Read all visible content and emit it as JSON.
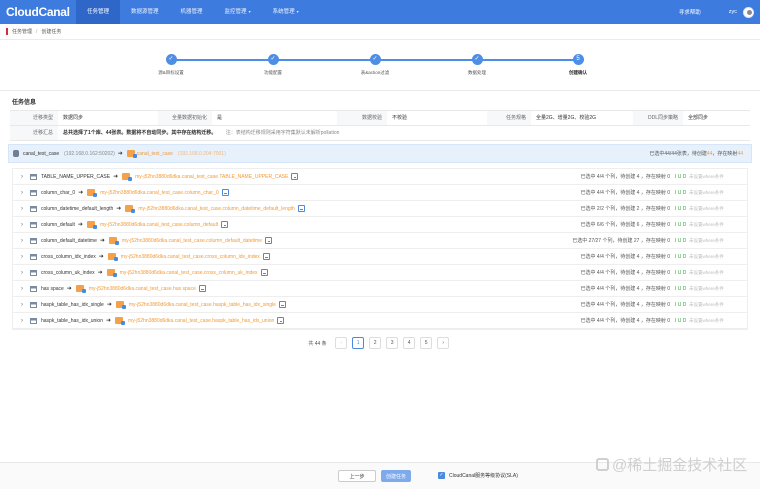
{
  "topbar": {
    "logo": "CloudCanal",
    "nav": [
      {
        "label": "任务管理",
        "active": true,
        "dropdown": false
      },
      {
        "label": "数据源管理",
        "active": false,
        "dropdown": false
      },
      {
        "label": "机器管理",
        "active": false,
        "dropdown": false
      },
      {
        "label": "监控管理",
        "active": false,
        "dropdown": true
      },
      {
        "label": "系统管理",
        "active": false,
        "dropdown": true
      }
    ],
    "help": "寻求帮助",
    "user": "zyc",
    "caret": "▾"
  },
  "breadcrumb": {
    "root": "任务管理",
    "sep": "/",
    "current": "创建任务"
  },
  "steps": [
    {
      "label": "源&目标设置",
      "check": "✓"
    },
    {
      "label": "功能配置",
      "check": "✓"
    },
    {
      "label": "表&action过滤",
      "check": "✓"
    },
    {
      "label": "数据处理",
      "check": "✓"
    },
    {
      "label": "创建确认",
      "check": "5"
    }
  ],
  "task_info": {
    "title": "任务信息",
    "row1": [
      {
        "label": "迁移类型",
        "value": "数据同步"
      },
      {
        "label": "全量数据初始化",
        "value": "是"
      },
      {
        "label": "数据校验",
        "value": "不校验"
      },
      {
        "label": "任务规格",
        "value": "全量2G、增量2G、校验2G"
      },
      {
        "label": "DDL同步策略",
        "value": "全部同步"
      }
    ],
    "summary_label": "迁移汇总",
    "summary_text": "总共选择了1个库、44张表。数据将不自动同步。其中存在结构迁移。",
    "summary_note": "注：表结构迁移规则采用字符集默认未解析pollation"
  },
  "db_bar": {
    "source_db": "canal_test_case",
    "source_host": "(192.168.0.162:50202)",
    "arrow": "➜",
    "target_db": "canal_test_case",
    "target_host": "(192.168.0.204:7001)",
    "summary_prefix": "已选中44/44张表，待创建",
    "summary_count": "44",
    "summary_mid": "，存在映射",
    "summary_count2": "44"
  },
  "rows": [
    {
      "expand": "›",
      "src": "TABLE_NAME_UPPER_CASE",
      "arrow": "➜",
      "dst": "my-j52hn3880d6dka.canal_test_case.TABLE_NAME_UPPER_CASE",
      "selected": "已选中 4/4 个列，待创建 4 ，存在映射 0",
      "iud": "I U D",
      "filter": "未设置where条件"
    },
    {
      "expand": "›",
      "src": "column_char_0",
      "arrow": "➜",
      "dst": "my-j52hn3880d6dka.canal_test_case.column_char_0",
      "selected": "已选中 4/4 个列，待创建 4 ，存在映射 0",
      "iud": "I U D",
      "filter": "未设置where条件"
    },
    {
      "expand": "›",
      "src": "column_datetime_default_length",
      "arrow": "➜",
      "dst": "my-j52hn3880d6dka.canal_test_case.column_datetime_default_length",
      "selected": "已选中 2/2 个列，待创建 2 ，存在映射 0",
      "iud": "I U D",
      "filter": "未设置where条件"
    },
    {
      "expand": "›",
      "src": "column_default",
      "arrow": "➜",
      "dst": "my-j52hn3880d6dka.canal_test_case.column_default",
      "selected": "已选中 6/6 个列，待创建 6 ，存在映射 0",
      "iud": "I U D",
      "filter": "未设置where条件"
    },
    {
      "expand": "›",
      "src": "column_default_datetime",
      "arrow": "➜",
      "dst": "my-j52hn3880d6dka.canal_test_case.column_default_datetime",
      "selected": "已选中 27/27 个列，待创建 27 ，存在映射 0",
      "iud": "I U D",
      "filter": "未设置where条件"
    },
    {
      "expand": "›",
      "src": "cross_column_idx_index",
      "arrow": "➜",
      "dst": "my-j52hn3880d6dka.canal_test_case.cross_column_idx_index",
      "selected": "已选中 4/4 个列，待创建 4 ，存在映射 0",
      "iud": "I U D",
      "filter": "未设置where条件"
    },
    {
      "expand": "›",
      "src": "cross_column_uk_index",
      "arrow": "➜",
      "dst": "my-j52hn3880d6dka.canal_test_case.cross_column_uk_index",
      "selected": "已选中 4/4 个列，待创建 4 ，存在映射 0",
      "iud": "I U D",
      "filter": "未设置where条件"
    },
    {
      "expand": "›",
      "src": "has space",
      "arrow": "➜",
      "dst": "my-j52hn3880d6dka.canal_test_case.has space",
      "selected": "已选中 4/4 个列，待创建 4 ，存在映射 0",
      "iud": "I U D",
      "filter": "未设置where条件"
    },
    {
      "expand": "›",
      "src": "haspk_table_has_idx_single",
      "arrow": "➜",
      "dst": "my-j52hn3880d6dka.canal_test_case.haspk_table_has_idx_single",
      "selected": "已选中 4/4 个列，待创建 4 ，存在映射 0",
      "iud": "I U D",
      "filter": "未设置where条件"
    },
    {
      "expand": "›",
      "src": "haspk_table_has_idx_union",
      "arrow": "➜",
      "dst": "my-j52hn3880d6dka.canal_test_case.haspk_table_has_idx_union",
      "selected": "已选中 4/4 个列，待创建 4 ，存在映射 0",
      "iud": "I U D",
      "filter": "未设置where条件"
    }
  ],
  "pagination": {
    "total": "共 44 条",
    "prev": "‹",
    "next": "›",
    "pages": [
      "1",
      "2",
      "3",
      "4",
      "5"
    ],
    "current": "1"
  },
  "footer": {
    "prev_button": "上一步",
    "create_button": "创建任务",
    "checkbox_mark": "✓",
    "agree_label": "CloudCanal服务等级协议(SLA)"
  },
  "watermark": "@稀土掘金技术社区",
  "colors": {
    "primary": "#3d7bdf",
    "accent_orange": "#f29b38",
    "iud_green": "#3aa34a",
    "step_blue": "#4d8ee6"
  }
}
